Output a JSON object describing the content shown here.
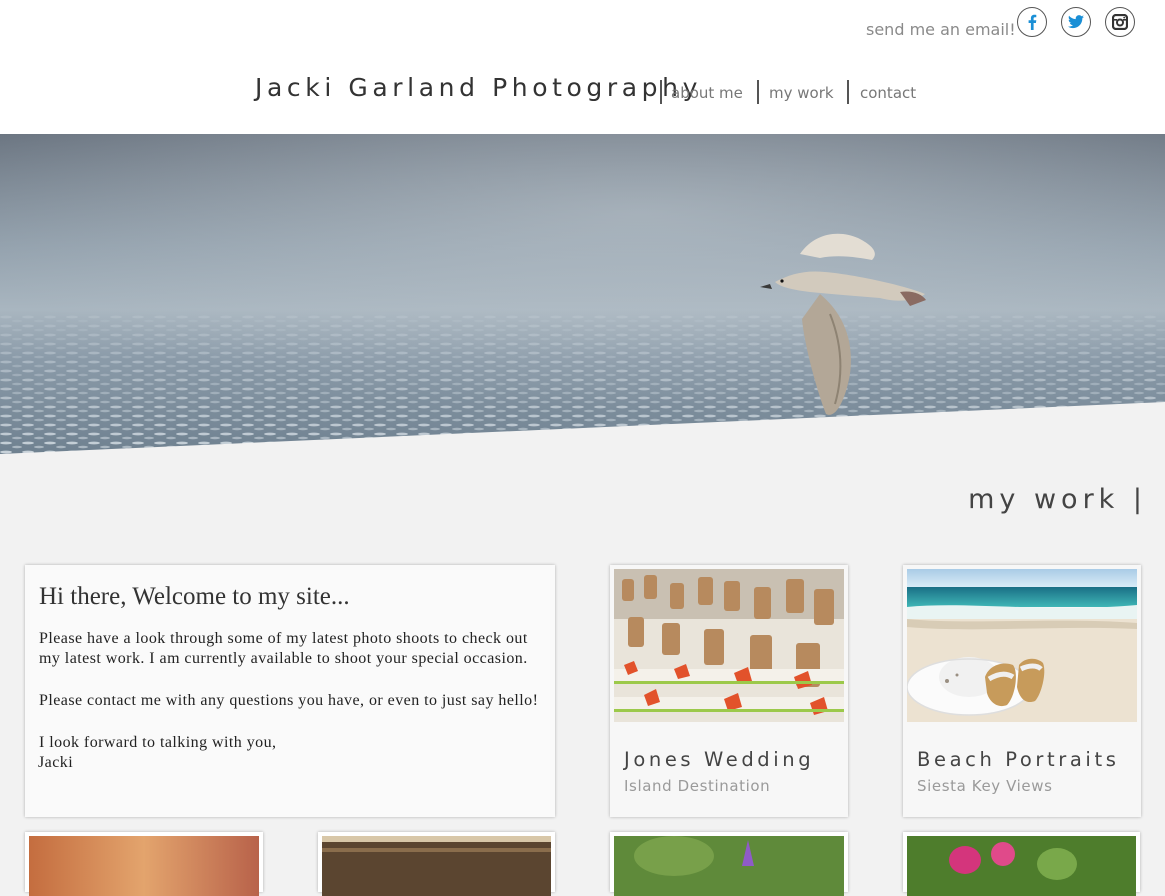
{
  "header": {
    "email_label": "send me an email!",
    "brand": "Jacki Garland Photography",
    "nav": [
      {
        "label": "about me"
      },
      {
        "label": "my work"
      },
      {
        "label": "contact"
      }
    ],
    "social_icons": [
      "facebook-icon",
      "twitter-icon",
      "instagram-icon"
    ],
    "social_icon_color": "#1a8fd6"
  },
  "hero": {
    "image": "seagull flying over sparkling sea"
  },
  "section": {
    "title": "my work |"
  },
  "welcome": {
    "heading": "Hi there, Welcome to my site...",
    "paragraph1": "Please have a look through some of my latest photo shoots to check out my latest work. I am currently available to shoot your special occasion.",
    "paragraph2": "Please contact me with any questions you have, or even to just say hello!",
    "closing": "I look forward to talking with you,",
    "signature": "Jacki"
  },
  "portfolio": [
    {
      "title": "Jones Wedding",
      "subtitle": "Island Destination"
    },
    {
      "title": "Beach Portraits",
      "subtitle": "Siesta Key Views"
    }
  ],
  "colors": {
    "background": "#f2f2f2",
    "header_bg": "#ffffff",
    "text_dark": "#333333",
    "text_muted": "#9a9a9a"
  }
}
